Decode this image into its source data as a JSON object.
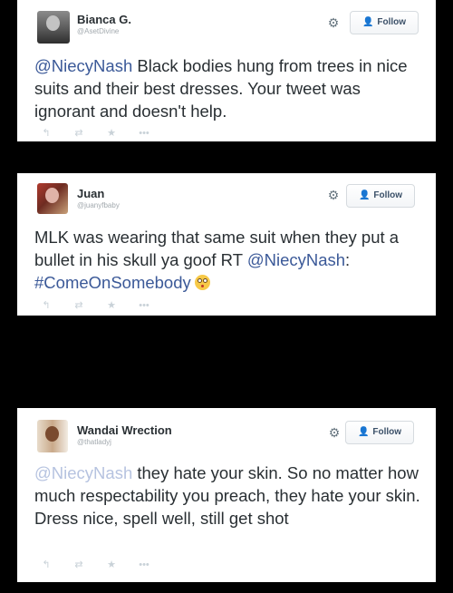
{
  "tweets": [
    {
      "display_name": "Bianca G.",
      "handle": "@AsetDivine",
      "avatar_icon": "profile-photo",
      "gear_icon": "gear-icon",
      "follow_label": "Follow",
      "mention": "@NiecyNash",
      "text": " Black bodies hung from trees in nice suits and their best dresses. Your tweet was ignorant and doesn't help.",
      "actions": [
        "reply-icon",
        "retweet-icon",
        "favorite-icon",
        "more-icon"
      ]
    },
    {
      "display_name": "Juan",
      "handle": "@juanyfbaby",
      "avatar_icon": "profile-photo",
      "gear_icon": "gear-icon",
      "follow_label": "Follow",
      "text_before": "MLK was wearing that same suit when they put a bullet in his skull ya goof RT ",
      "mention": "@NiecyNash",
      "colon": ": ",
      "hashtag": "#ComeOnSomebody",
      "emoji": "flushed-face",
      "actions": [
        "reply-icon",
        "retweet-icon",
        "favorite-icon",
        "more-icon"
      ]
    },
    {
      "display_name": "Wandai Wrection",
      "handle": "@thatladyj",
      "avatar_icon": "profile-photo",
      "gear_icon": "gear-icon",
      "follow_label": "Follow",
      "mention": "@NiecyNash",
      "text": " they hate your skin. So no matter how much respectability you preach, they hate your skin. Dress nice, spell well, still get shot",
      "actions": [
        "reply-icon",
        "retweet-icon",
        "favorite-icon",
        "more-icon"
      ]
    }
  ],
  "colors": {
    "background": "#000000",
    "card": "#ffffff",
    "link": "#3b5998",
    "text": "#292f33",
    "follow_icon": "#3b94d9"
  }
}
